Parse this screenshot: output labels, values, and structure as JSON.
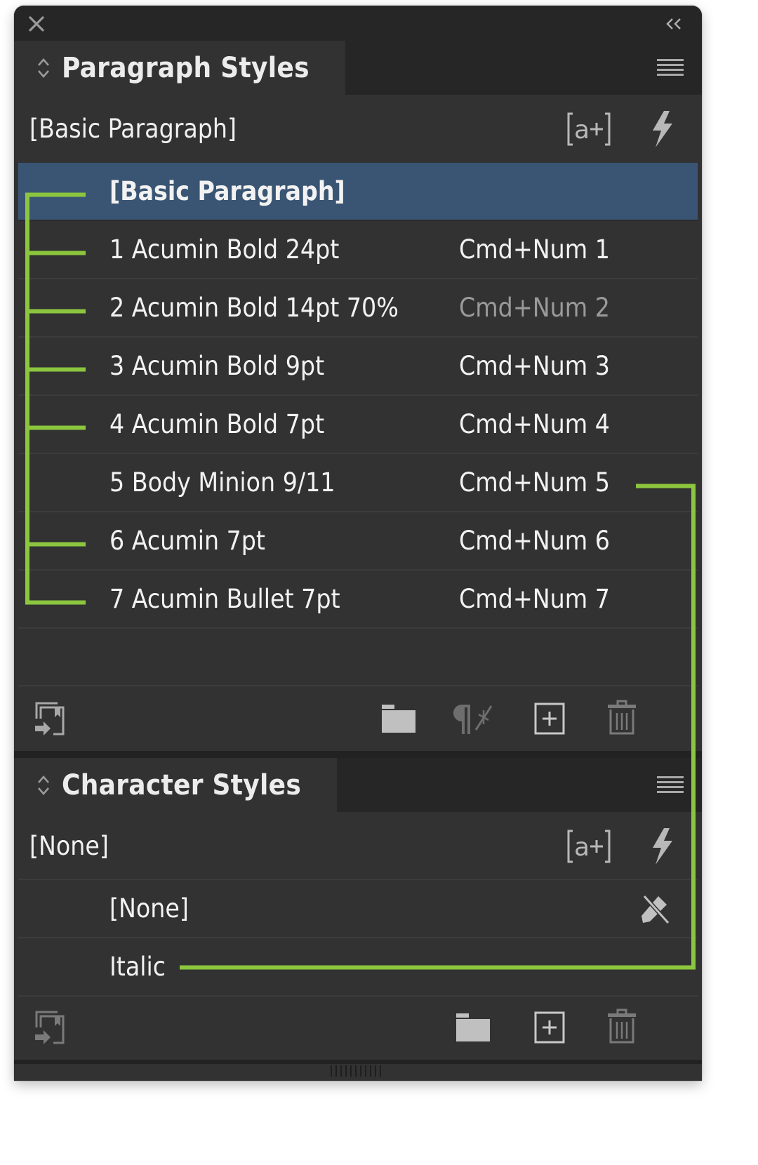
{
  "colors": {
    "panel_bg": "#323232",
    "titlebar_bg": "#262626",
    "selection_bg": "#3a5573",
    "connector_green": "#8cc63f",
    "text": "#f2f2f2",
    "text_dim": "#9a9a9a",
    "icon": "#b8b8b8"
  },
  "titlebar": {
    "close_icon": "close-icon",
    "collapse_icon": "double-chevron-left-icon"
  },
  "paragraph_styles": {
    "tab_title": "Paragraph Styles",
    "current_style": "[Basic Paragraph]",
    "header_icons": [
      "create-style-override-icon",
      "quick-apply-icon"
    ],
    "rows": [
      {
        "name": "[Basic Paragraph]",
        "shortcut": "",
        "selected": true
      },
      {
        "name": "1 Acumin Bold 24pt",
        "shortcut": "Cmd+Num 1",
        "selected": false
      },
      {
        "name": "2 Acumin Bold 14pt 70%",
        "shortcut": "Cmd+Num 2",
        "selected": false,
        "shortcut_dimmed": true
      },
      {
        "name": "3 Acumin Bold 9pt",
        "shortcut": "Cmd+Num 3",
        "selected": false
      },
      {
        "name": "4 Acumin Bold 7pt",
        "shortcut": "Cmd+Num 4",
        "selected": false
      },
      {
        "name": "5 Body Minion 9/11",
        "shortcut": "Cmd+Num 5",
        "selected": false
      },
      {
        "name": "6 Acumin 7pt",
        "shortcut": "Cmd+Num 6",
        "selected": false
      },
      {
        "name": "7 Acumin Bullet 7pt",
        "shortcut": "Cmd+Num 7",
        "selected": false
      }
    ],
    "toolbar": [
      "load-styles-icon",
      "new-group-folder-icon",
      "clear-overrides-icon",
      "new-style-icon",
      "delete-style-icon"
    ]
  },
  "character_styles": {
    "tab_title": "Character Styles",
    "current_style": "[None]",
    "header_icons": [
      "create-style-override-icon",
      "quick-apply-icon"
    ],
    "rows": [
      {
        "name": "[None]",
        "locked": true
      },
      {
        "name": "Italic",
        "locked": false
      }
    ],
    "toolbar": [
      "load-styles-icon",
      "new-group-folder-icon",
      "new-style-icon",
      "delete-style-icon"
    ]
  }
}
